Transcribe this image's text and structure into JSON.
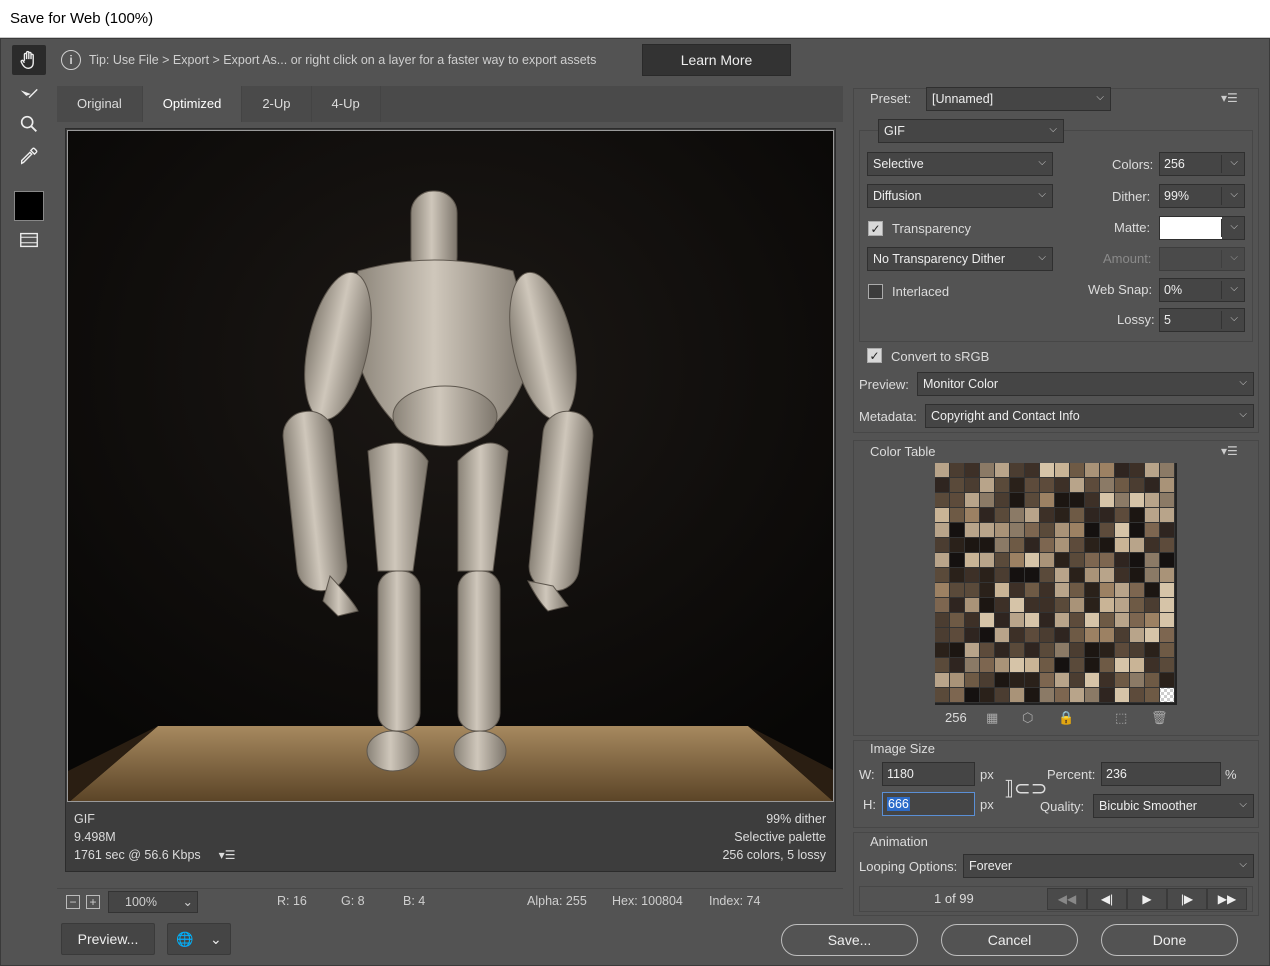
{
  "window": {
    "title": "Save for Web (100%)"
  },
  "tip": {
    "text": "Tip: Use File > Export > Export As...  or right click on a layer for a faster way to export assets",
    "learn_more": "Learn More"
  },
  "tabs": [
    {
      "label": "Original"
    },
    {
      "label": "Optimized"
    },
    {
      "label": "2-Up"
    },
    {
      "label": "4-Up"
    }
  ],
  "active_tab": "Optimized",
  "preview_info": {
    "format": "GIF",
    "size": "9.498M",
    "time": "1761 sec @ 56.6 Kbps",
    "dither": "99% dither",
    "palette": "Selective palette",
    "colors_lossy": "256 colors, 5 lossy"
  },
  "status": {
    "zoom": "100%",
    "r": "R: 16",
    "g": "G: 8",
    "b": "B: 4",
    "alpha": "Alpha: 255",
    "hex": "Hex: 100804",
    "index": "Index: 74"
  },
  "bottom_buttons": {
    "preview": "Preview...",
    "save": "Save...",
    "cancel": "Cancel",
    "done": "Done"
  },
  "settings": {
    "preset_label": "Preset:",
    "preset": "[Unnamed]",
    "format": "GIF",
    "reduction": "Selective",
    "dither_algo": "Diffusion",
    "transparency_label": "Transparency",
    "transparency_checked": true,
    "transparency_dither": "No Transparency Dither",
    "interlaced_label": "Interlaced",
    "interlaced_checked": false,
    "colors_label": "Colors:",
    "colors": "256",
    "dither_label": "Dither:",
    "dither": "99%",
    "matte_label": "Matte:",
    "amount_label": "Amount:",
    "websnap_label": "Web Snap:",
    "websnap": "0%",
    "lossy_label": "Lossy:",
    "lossy": "5",
    "convert_srgb_label": "Convert to sRGB",
    "convert_srgb_checked": true,
    "preview_label": "Preview:",
    "preview": "Monitor Color",
    "metadata_label": "Metadata:",
    "metadata": "Copyright and Contact Info"
  },
  "color_table": {
    "title": "Color Table",
    "count": "256",
    "colors": [
      "#2a211a",
      "#3d3027",
      "#5a4a3a",
      "#8b7a66",
      "#a99378",
      "#1c1612",
      "#6e5a45",
      "#b8a48a",
      "#4b3d31",
      "#c9b496",
      "#2f2520",
      "#7d6650",
      "#9c8163",
      "#151110",
      "#d6c4a8",
      "#5d4b3b"
    ]
  },
  "image_size": {
    "title": "Image Size",
    "w_label": "W:",
    "w": "1180",
    "h_label": "H:",
    "h": "666",
    "unit": "px",
    "percent_label": "Percent:",
    "percent": "236",
    "percent_unit": "%",
    "quality_label": "Quality:",
    "quality": "Bicubic Smoother"
  },
  "animation": {
    "title": "Animation",
    "looping_label": "Looping Options:",
    "looping": "Forever",
    "frame_counter": "1 of 99"
  }
}
